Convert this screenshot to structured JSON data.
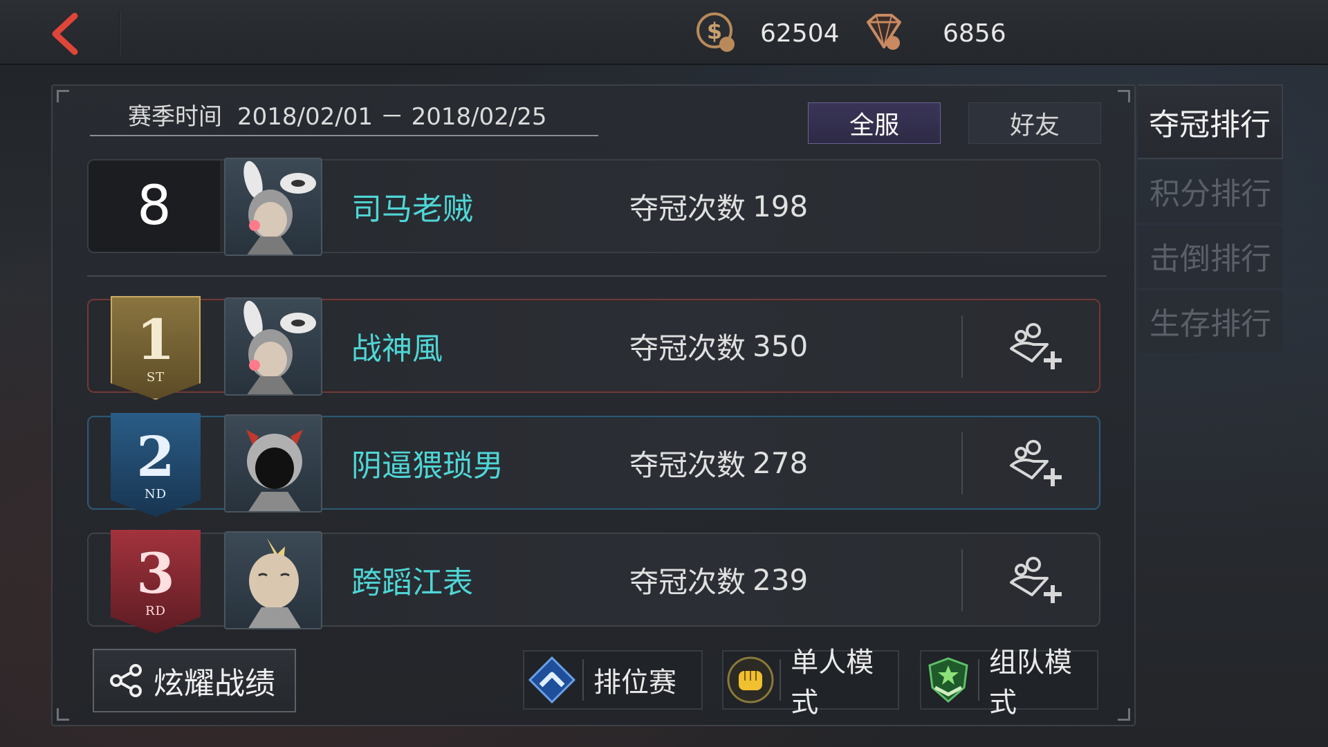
{
  "topbar": {
    "back_icon": "back-arrow-icon",
    "coins": "62504",
    "gems": "6856"
  },
  "season": {
    "label": "赛季时间",
    "range": "2018/02/01 － 2018/02/25"
  },
  "scope_tabs": {
    "all": "全服",
    "friends": "好友",
    "selected": "全服"
  },
  "my_rank": {
    "rank": "8",
    "name": "司马老贼",
    "wins_label": "夺冠次数",
    "wins": "198"
  },
  "leaderboard": [
    {
      "rank": "1",
      "suffix": "ST",
      "name": "战神風",
      "wins_label": "夺冠次数",
      "wins": "350"
    },
    {
      "rank": "2",
      "suffix": "ND",
      "name": "阴逼猥琐男",
      "wins_label": "夺冠次数",
      "wins": "278"
    },
    {
      "rank": "3",
      "suffix": "RD",
      "name": "跨蹈江表",
      "wins_label": "夺冠次数",
      "wins": "239"
    }
  ],
  "side_tabs": [
    {
      "label": "夺冠排行",
      "active": true
    },
    {
      "label": "积分排行",
      "active": false
    },
    {
      "label": "击倒排行",
      "active": false
    },
    {
      "label": "生存排行",
      "active": false
    }
  ],
  "bottom": {
    "share": "炫耀战绩",
    "modes": {
      "ranked": "排位赛",
      "solo": "单人模式",
      "team": "组队模式"
    }
  },
  "colors": {
    "player_name": "#4fd6d6",
    "accent_back": "#e0453a",
    "rank1": "#c9ab62",
    "rank2": "#2a5c86",
    "rank3": "#a3333d"
  }
}
